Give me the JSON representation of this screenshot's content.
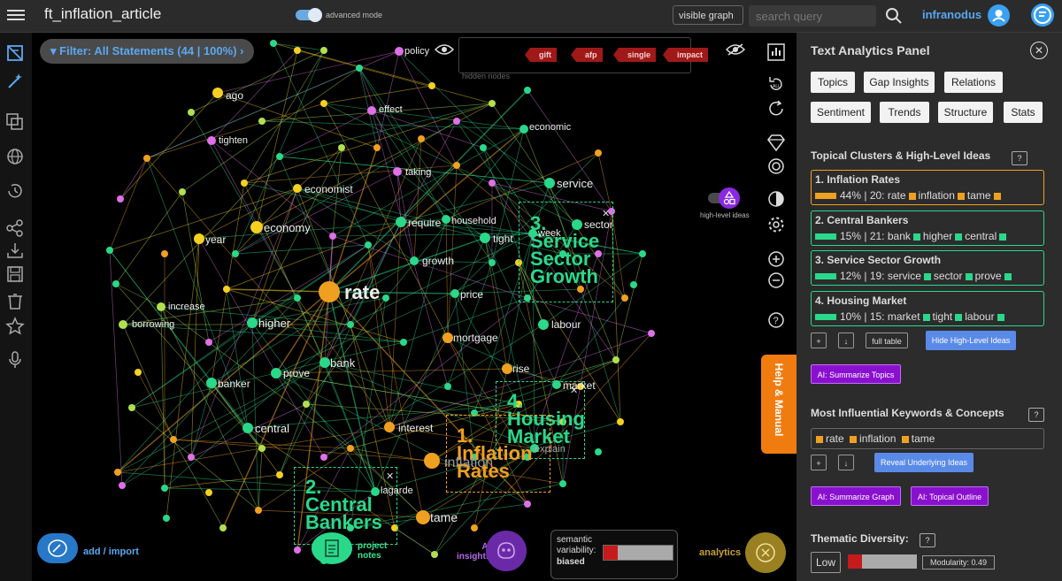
{
  "app": {
    "title": "ft_inflation_article",
    "advanced_label": "advanced mode",
    "graph_select": "visible graph",
    "search_placeholder": "search query",
    "user": "infranodus"
  },
  "toolbar_icons": [
    "menu-icon",
    "toggle-icon",
    "search-icon",
    "user-icon",
    "logo-icon"
  ],
  "graph": {
    "filter": "Filter: All Statements (44 | 100%)",
    "hidden_nodes_label": "hidden nodes",
    "hidden_tags": [
      "gift",
      "afp",
      "single",
      "impact"
    ],
    "nodes": [
      {
        "label": "rate",
        "color": "#f0a020"
      },
      {
        "label": "inflation",
        "color": "#f0a020"
      },
      {
        "label": "tame",
        "color": "#f0a020"
      },
      {
        "label": "mortgage",
        "color": "#f0a020"
      },
      {
        "label": "rise",
        "color": "#f0a020"
      },
      {
        "label": "interest",
        "color": "#f0a020"
      },
      {
        "label": "economy",
        "color": "#f5d020"
      },
      {
        "label": "year",
        "color": "#f5d020"
      },
      {
        "label": "ago",
        "color": "#f5d020"
      },
      {
        "label": "economist",
        "color": "#f5d020"
      },
      {
        "label": "higher",
        "color": "#2ad88a"
      },
      {
        "label": "bank",
        "color": "#2ad88a"
      },
      {
        "label": "banker",
        "color": "#2ad88a"
      },
      {
        "label": "prove",
        "color": "#2ad88a"
      },
      {
        "label": "central",
        "color": "#2ad88a"
      },
      {
        "label": "lagarde",
        "color": "#2ad88a"
      },
      {
        "label": "service",
        "color": "#2ad88a"
      },
      {
        "label": "sector",
        "color": "#2ad88a"
      },
      {
        "label": "week",
        "color": "#2ad88a"
      },
      {
        "label": "require",
        "color": "#2ad88a"
      },
      {
        "label": "household",
        "color": "#2ad88a"
      },
      {
        "label": "tight",
        "color": "#2ad88a"
      },
      {
        "label": "growth",
        "color": "#2ad88a"
      },
      {
        "label": "price",
        "color": "#2ad88a"
      },
      {
        "label": "labour",
        "color": "#2ad88a"
      },
      {
        "label": "market",
        "color": "#2ad88a"
      },
      {
        "label": "explain",
        "color": "#2ad88a"
      },
      {
        "label": "economic",
        "color": "#2ad88a"
      },
      {
        "label": "increase",
        "color": "#b0e050"
      },
      {
        "label": "borrowing",
        "color": "#b0e050"
      },
      {
        "label": "policy",
        "color": "#e070e8"
      },
      {
        "label": "effect",
        "color": "#e070e8"
      },
      {
        "label": "tighten",
        "color": "#e070e8"
      },
      {
        "label": "taking",
        "color": "#e070e8"
      }
    ],
    "clusters": [
      {
        "label": "1.\nInflation\nRates",
        "color": "#f0a020"
      },
      {
        "label": "2.\nCentral\nBankers",
        "color": "#2ad88a"
      },
      {
        "label": "3.\nService\nSector\nGrowth",
        "color": "#2ad88a"
      },
      {
        "label": "4.\nHousing\nMarket",
        "color": "#2ad88a"
      }
    ],
    "add_import": "add / import",
    "project_notes": "project\nnotes",
    "ai_insights": "AI\ninsights",
    "semantic_title": "semantic\nvariability:",
    "semantic_value": "biased",
    "semantic_level": 0.2,
    "analytics_label": "analytics",
    "high_level_label": "high-level ideas",
    "help_manual": "Help & Manual"
  },
  "panel": {
    "title": "Text Analytics Panel",
    "tabs_row1": [
      "Topics",
      "Gap Insights",
      "Relations"
    ],
    "tabs_row2": [
      "Sentiment",
      "Trends",
      "Structure",
      "Stats"
    ],
    "topics_heading": "Topical Clusters & High-Level Ideas",
    "topics": [
      {
        "name": "1. Inflation Rates",
        "percent": "44%",
        "count": "20:",
        "keywords": [
          "rate",
          "inflation",
          "tame"
        ],
        "color": "#f0a020"
      },
      {
        "name": "2. Central Bankers",
        "percent": "15%",
        "count": "21:",
        "keywords": [
          "bank",
          "higher",
          "central"
        ],
        "color": "#2ad88a"
      },
      {
        "name": "3. Service Sector Growth",
        "percent": "12%",
        "count": "19:",
        "keywords": [
          "service",
          "sector",
          "prove"
        ],
        "color": "#2ad88a"
      },
      {
        "name": "4. Housing Market",
        "percent": "10%",
        "count": "15:",
        "keywords": [
          "market",
          "tight",
          "labour"
        ],
        "color": "#2ad88a"
      }
    ],
    "plus_label": "+",
    "down_label": "↓",
    "full_table": "full table",
    "hide_high_level": "Hide High-Level Ideas",
    "ai_summarize_topics": "AI: Summarize Topics",
    "keywords_heading": "Most Influential Keywords & Concepts",
    "keywords": [
      "rate",
      "inflation",
      "tame"
    ],
    "reveal_ideas": "Reveal Underlying Ideas",
    "ai_summarize_graph": "AI: Summarize Graph",
    "ai_topical_outline": "AI: Topical Outline",
    "diversity_heading": "Thematic Diversity:",
    "diversity_value": "Low",
    "diversity_level": 0.2,
    "modularity": "Modularity: 0.49",
    "qmark": "?"
  },
  "colors": {
    "accent": "#3aa0f0",
    "orange": "#f0a020",
    "green": "#2ad88a",
    "purple": "#8a10d0",
    "pink": "#e070e8",
    "red": "#c61b1b"
  }
}
